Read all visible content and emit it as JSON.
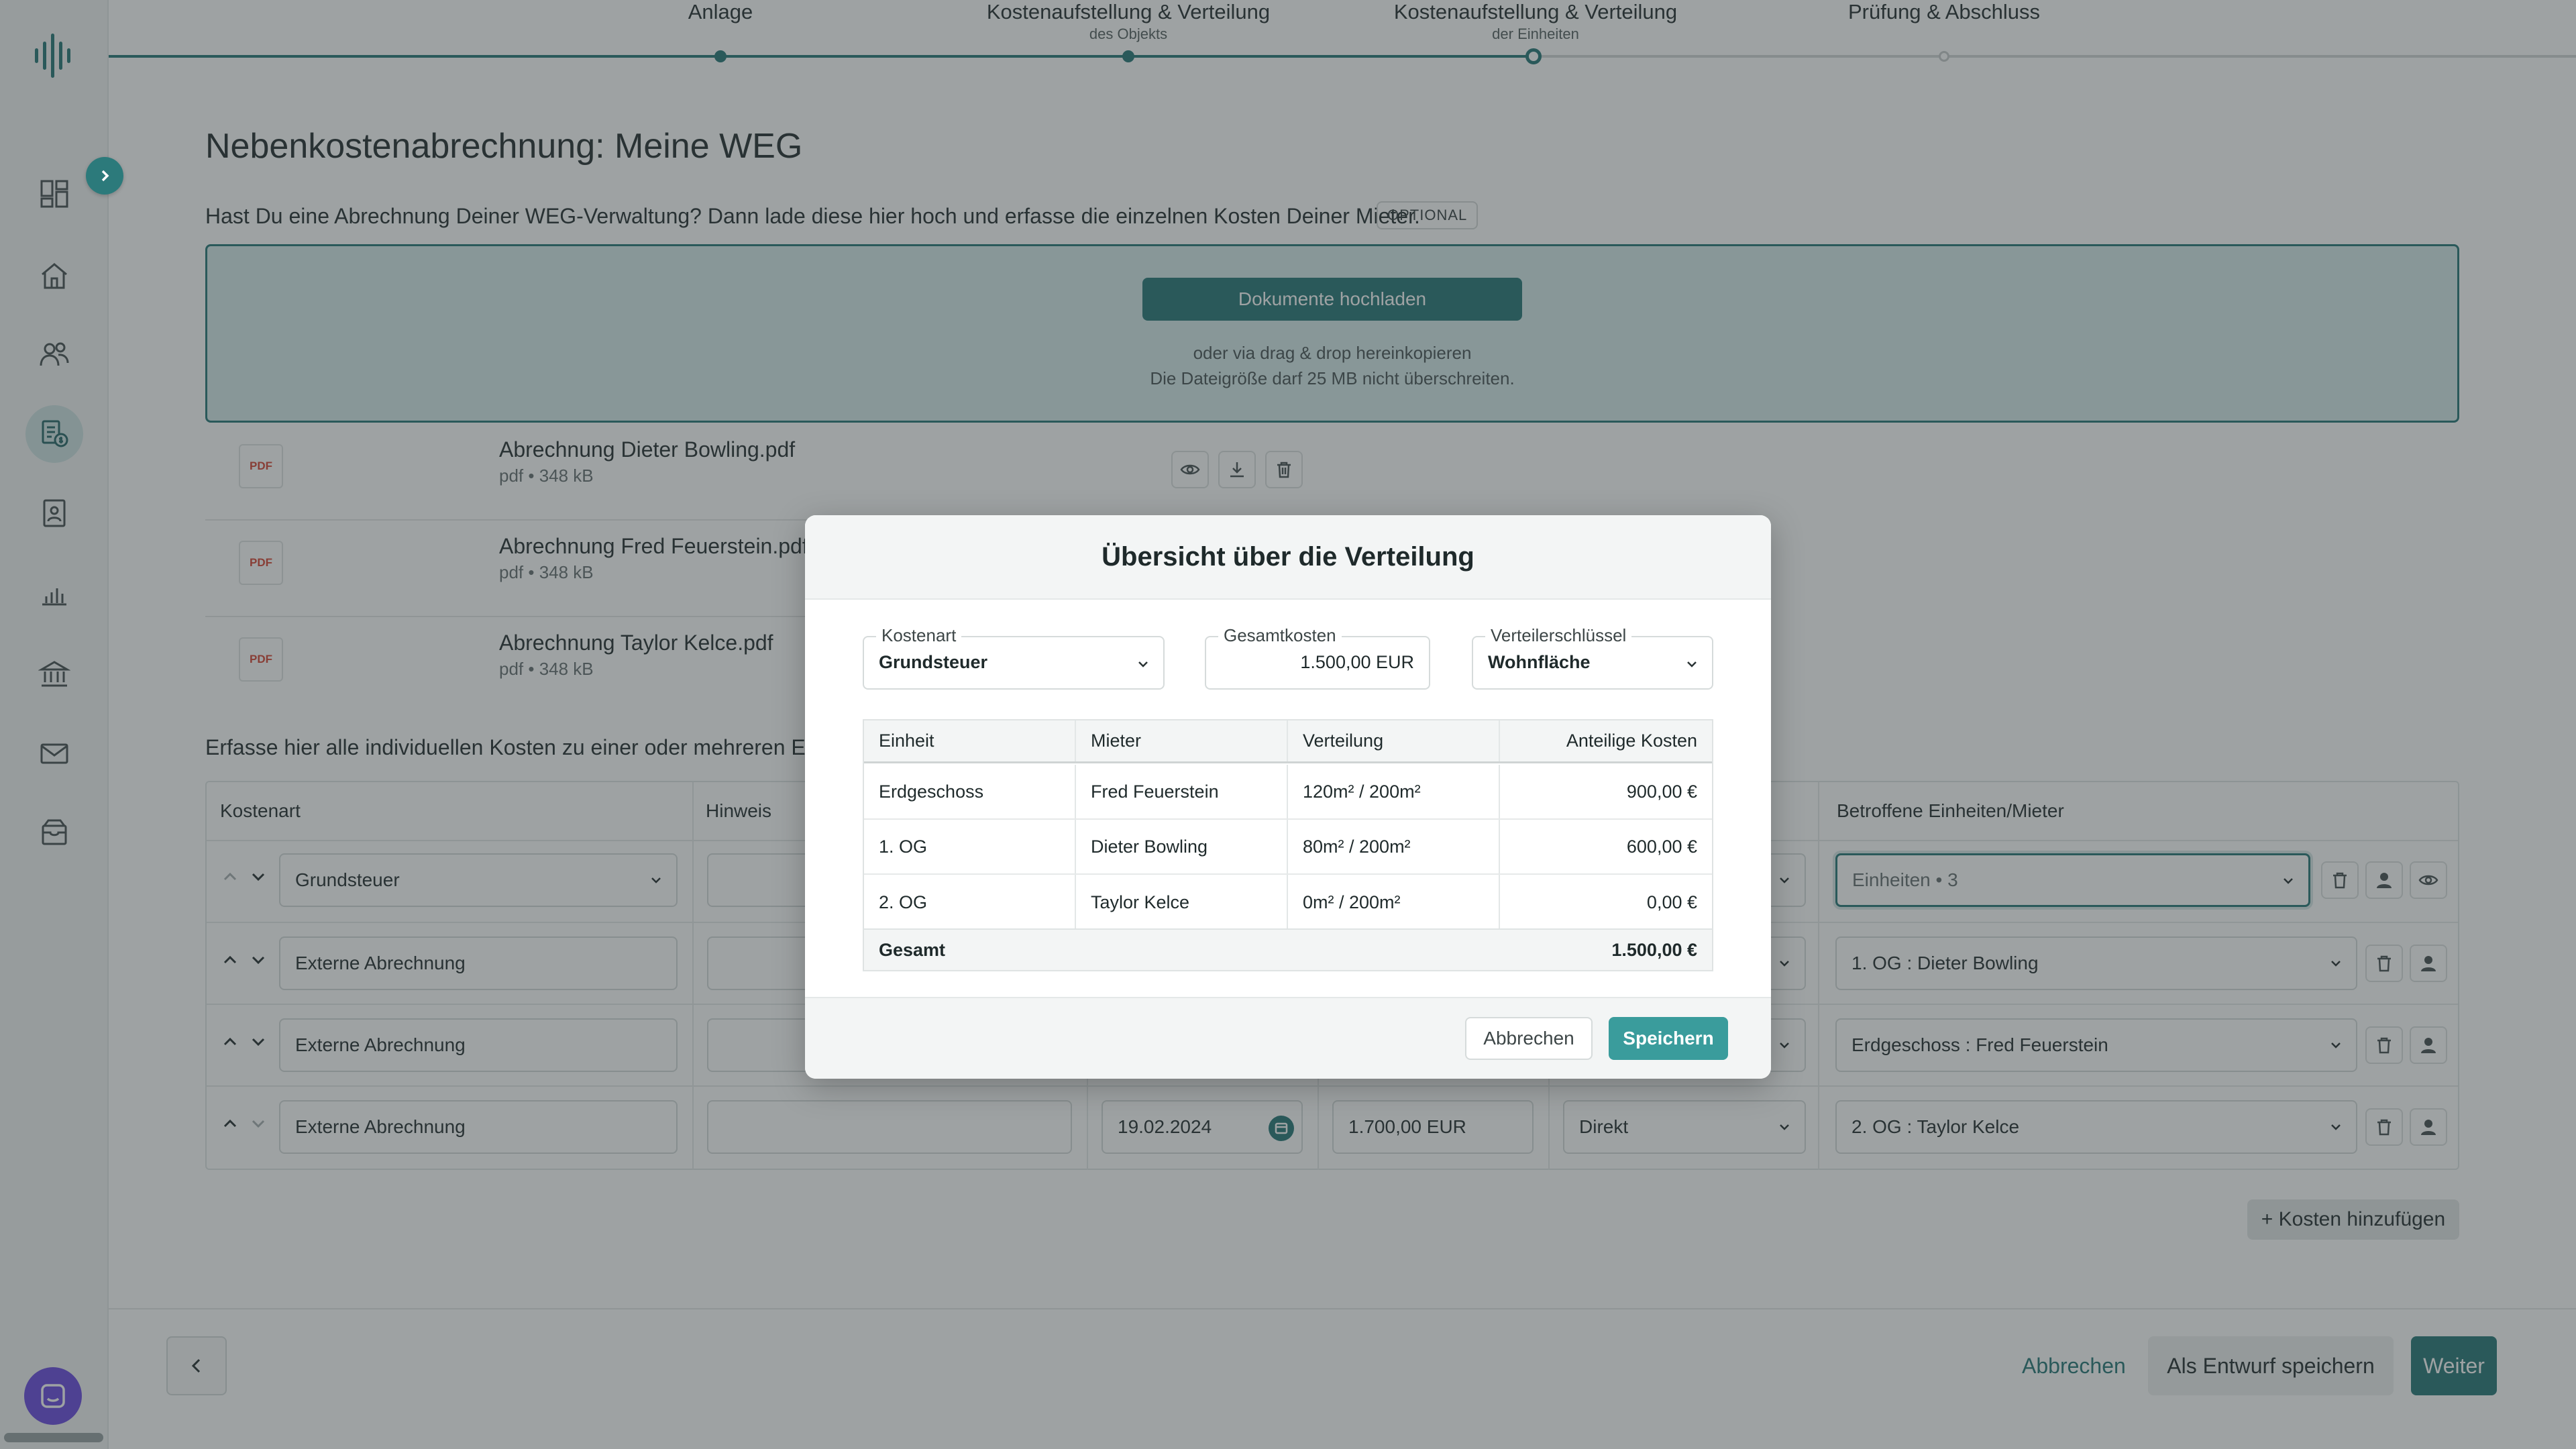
{
  "stepper": {
    "steps": [
      {
        "label": "Anlage",
        "sub": ""
      },
      {
        "label": "Kostenaufstellung & Verteilung",
        "sub": "des Objekts"
      },
      {
        "label": "Kostenaufstellung & Verteilung",
        "sub": "der Einheiten"
      },
      {
        "label": "Prüfung & Abschluss",
        "sub": ""
      }
    ],
    "current_step": 3
  },
  "page": {
    "title": "Nebenkostenabrechnung: Meine WEG",
    "upload_hint": "Hast Du eine Abrechnung Deiner WEG-Verwaltung? Dann lade diese hier hoch und erfasse die einzelnen Kosten Deiner Mieter.",
    "optional_badge": "OPTIONAL"
  },
  "dropzone": {
    "button_label": "Dokumente hochladen",
    "drag_text": "oder via drag & drop hereinkopieren",
    "size_text": "Die Dateigröße darf 25 MB nicht überschreiten."
  },
  "files": [
    {
      "icon_label": "PDF",
      "name": "Abrechnung Dieter Bowling.pdf",
      "meta": "pdf • 348 kB"
    },
    {
      "icon_label": "PDF",
      "name": "Abrechnung Fred Feuerstein.pdf",
      "meta": "pdf • 348 kB"
    },
    {
      "icon_label": "PDF",
      "name": "Abrechnung Taylor Kelce.pdf",
      "meta": "pdf • 348 kB"
    }
  ],
  "costs": {
    "hint": "Erfasse hier alle individuellen Kosten zu einer oder mehreren Einh",
    "headers": {
      "kostenart": "Kostenart",
      "hinweis": "Hinweis",
      "betroffene": "Betroffene Einheiten/Mieter"
    },
    "rows": [
      {
        "kostenart": "Grundsteuer",
        "betroffene": "Einheiten • 3"
      },
      {
        "kostenart": "Externe Abrechnung",
        "betroffene": "1. OG : Dieter Bowling"
      },
      {
        "kostenart": "Externe Abrechnung",
        "betroffene": "Erdgeschoss : Fred Feuerstein"
      },
      {
        "kostenart": "Externe Abrechnung",
        "date": "19.02.2024",
        "amount": "1.700,00  EUR",
        "schluessel": "Direkt",
        "betroffene": "2. OG : Taylor Kelce"
      }
    ],
    "add_label": "+ Kosten hinzufügen"
  },
  "footer": {
    "cancel_label": "Abbrechen",
    "draft_label": "Als Entwurf speichern",
    "next_label": "Weiter"
  },
  "modal": {
    "title": "Übersicht über die Verteilung",
    "kostenart_label": "Kostenart",
    "kostenart_value": "Grundsteuer",
    "gesamt_label": "Gesamtkosten",
    "gesamt_value": "1.500,00  EUR",
    "schluessel_label": "Verteilerschlüssel",
    "schluessel_value": "Wohnfläche",
    "table": {
      "headers": [
        "Einheit",
        "Mieter",
        "Verteilung",
        "Anteilige Kosten"
      ],
      "rows": [
        [
          "Erdgeschoss",
          "Fred Feuerstein",
          "120m² / 200m²",
          "900,00 €"
        ],
        [
          "1. OG",
          "Dieter Bowling",
          "80m² / 200m²",
          "600,00 €"
        ],
        [
          "2. OG",
          "Taylor Kelce",
          "0m² / 200m²",
          "0,00 €"
        ]
      ],
      "total_label": "Gesamt",
      "total_value": "1.500,00 €"
    },
    "cancel_label": "Abbrechen",
    "save_label": "Speichern"
  },
  "colors": {
    "accent": "#2c7a7b",
    "chat": "#6d4fe0",
    "pdf": "#d84a3a"
  },
  "icons": {
    "sidebar": [
      "dashboard-icon",
      "home-icon",
      "users-icon",
      "billing-icon",
      "contacts-icon",
      "chart-icon",
      "bank-icon",
      "mail-icon",
      "archive-icon"
    ]
  }
}
